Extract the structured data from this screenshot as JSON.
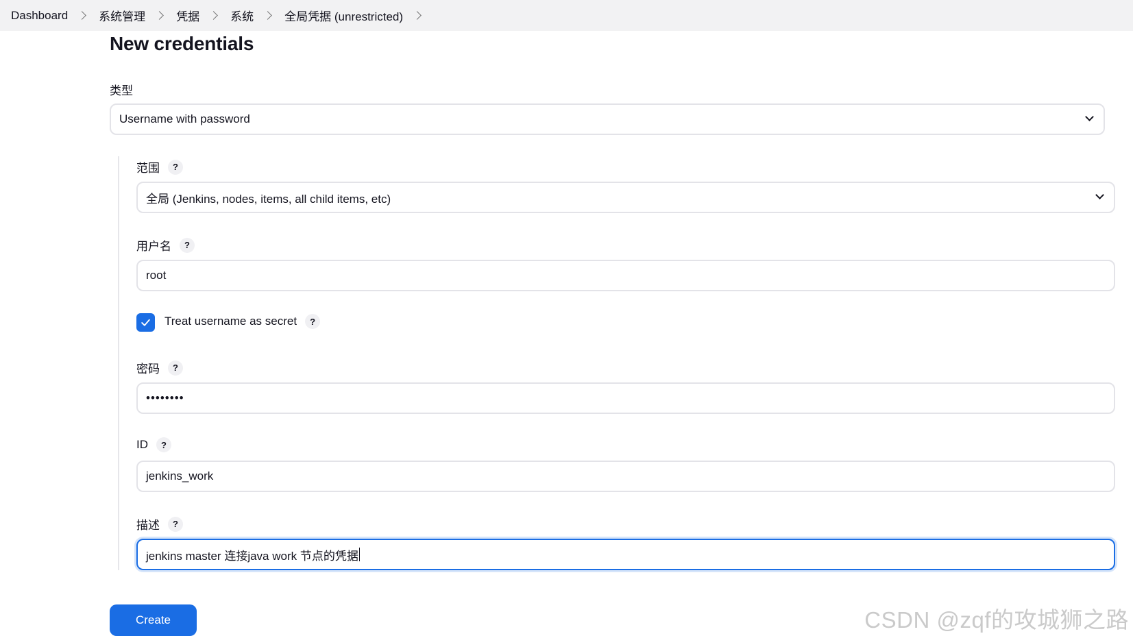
{
  "breadcrumb": {
    "items": [
      {
        "label": "Dashboard"
      },
      {
        "label": "系统管理"
      },
      {
        "label": "凭据"
      },
      {
        "label": "系统"
      },
      {
        "label": "全局凭据 (unrestricted)"
      }
    ]
  },
  "page": {
    "title": "New credentials"
  },
  "form": {
    "kind": {
      "label": "类型",
      "value": "Username with password"
    },
    "scope": {
      "label": "范围",
      "help": "?",
      "value": "全局 (Jenkins, nodes, items, all child items, etc)"
    },
    "username": {
      "label": "用户名",
      "help": "?",
      "value": "root"
    },
    "treat_secret": {
      "label": "Treat username as secret",
      "help": "?",
      "checked": true
    },
    "password": {
      "label": "密码",
      "help": "?",
      "value": "••••••••"
    },
    "id": {
      "label": "ID",
      "help": "?",
      "value": "jenkins_work"
    },
    "description": {
      "label": "描述",
      "help": "?",
      "value": "jenkins master 连接java work 节点的凭据"
    },
    "create_label": "Create"
  },
  "watermark": "CSDN @zqf的攻城狮之路",
  "colors": {
    "accent": "#1a6de4",
    "breadcrumb_bg": "#f2f2f3",
    "border": "#e3e3e8"
  }
}
